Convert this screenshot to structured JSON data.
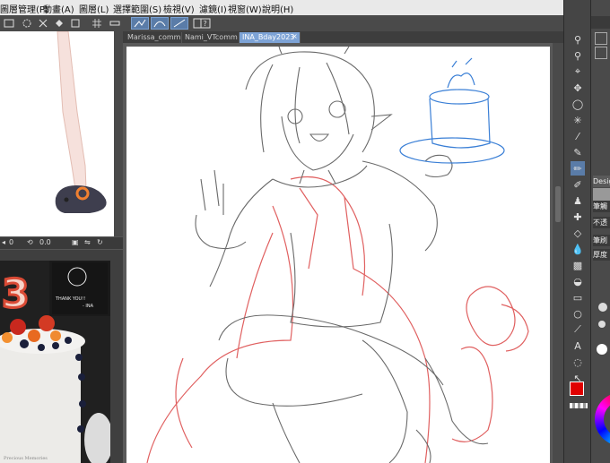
{
  "menu": {
    "items": [
      "圖層管理(P)",
      "動畫(A)",
      "圖層(L)",
      "選擇範圍(S)",
      "檢視(V)",
      "濾鏡(I)",
      "視窗(W)",
      "說明(H)"
    ]
  },
  "navigator": {
    "value_1": "0",
    "value_2": "0.0"
  },
  "tabs": [
    {
      "label": "Marissa_comm"
    },
    {
      "label": "Nami_VTcomm"
    },
    {
      "label": "INA_Bday2023"
    }
  ],
  "reference_photo": {
    "cake_number": "3",
    "note_line1": "THANK YOU!!",
    "note_line2": "- INA",
    "cake_caption": "Precious Memories"
  },
  "right_panel": {
    "items": [
      "Design",
      "筆觸",
      "不透",
      "筆刷",
      "厚度"
    ]
  },
  "colors": {
    "accent": "#7da3d6",
    "sketch_gray": "#6a6a6a",
    "sketch_red": "#e06060",
    "sketch_blue": "#3a7fd6",
    "main_color": "#e00000"
  }
}
